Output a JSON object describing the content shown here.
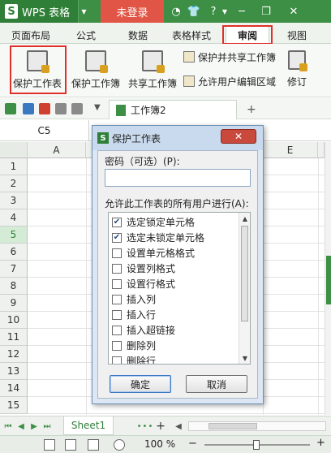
{
  "titlebar": {
    "app_name": "WPS 表格",
    "logo_letter": "S",
    "login_label": "未登录"
  },
  "menu": {
    "tabs": [
      {
        "label": "页面布局"
      },
      {
        "label": "公式"
      },
      {
        "label": "数据"
      },
      {
        "label": "表格样式"
      },
      {
        "label": "审阅"
      },
      {
        "label": "视图"
      }
    ]
  },
  "ribbon": {
    "protect_sheet": "保护工作表",
    "protect_workbook": "保护工作簿",
    "share_workbook": "共享工作簿",
    "protect_and_share": "保护并共享工作簿",
    "allow_user_edit": "允许用户编辑区域",
    "revise": "修订"
  },
  "quick_access": {
    "doc_tab_label": "工作簿2"
  },
  "formula_bar": {
    "cell_ref": "C5"
  },
  "grid": {
    "columns": [
      "A",
      "E"
    ],
    "rows": [
      "1",
      "2",
      "3",
      "4",
      "5",
      "6",
      "7",
      "8",
      "9",
      "10",
      "11",
      "12",
      "13",
      "14",
      "15"
    ],
    "selected_row": "5"
  },
  "sheets": {
    "active": "Sheet1"
  },
  "status": {
    "zoom": "100 %"
  },
  "dialog": {
    "title": "保护工作表",
    "password_label": "密码（可选）(P):",
    "password_value": "",
    "permissions_label": "允许此工作表的所有用户进行(A):",
    "permissions": [
      {
        "label": "选定锁定单元格",
        "checked": true
      },
      {
        "label": "选定未锁定单元格",
        "checked": true
      },
      {
        "label": "设置单元格格式",
        "checked": false
      },
      {
        "label": "设置列格式",
        "checked": false
      },
      {
        "label": "设置行格式",
        "checked": false
      },
      {
        "label": "插入列",
        "checked": false
      },
      {
        "label": "插入行",
        "checked": false
      },
      {
        "label": "插入超链接",
        "checked": false
      },
      {
        "label": "删除列",
        "checked": false
      },
      {
        "label": "删除行",
        "checked": false
      }
    ],
    "ok_label": "确定",
    "cancel_label": "取消"
  },
  "colors": {
    "brand_green": "#3c8f45",
    "login_red": "#e05545",
    "highlight_red": "#e0302a"
  }
}
